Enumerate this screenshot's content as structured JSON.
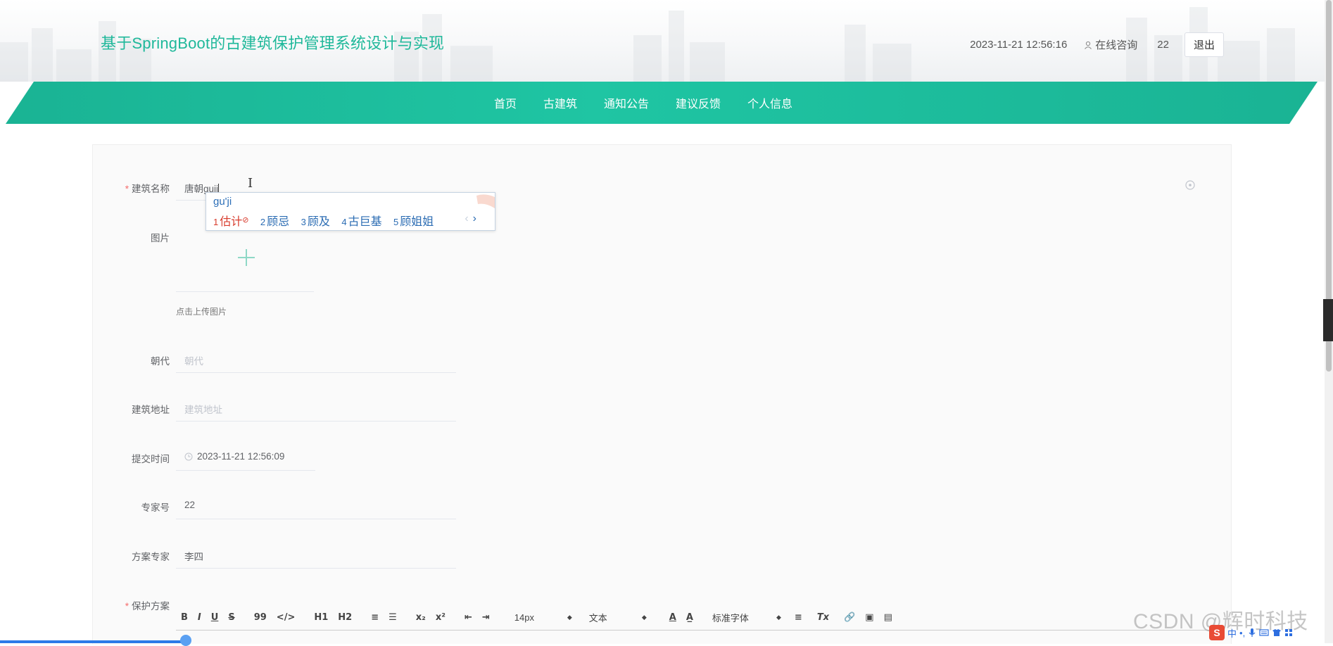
{
  "header": {
    "title": "基于SpringBoot的古建筑保护管理系统设计与实现",
    "datetime": "2023-11-21 12:56:16",
    "consult_label": "在线咨询",
    "user_id": "22",
    "logout_label": "退出"
  },
  "nav": {
    "items": [
      "首页",
      "古建筑",
      "通知公告",
      "建议反馈",
      "个人信息"
    ]
  },
  "form": {
    "building_name": {
      "label": "建筑名称",
      "value": "唐朝guij"
    },
    "image": {
      "label": "图片",
      "tip": "点击上传图片"
    },
    "dynasty": {
      "label": "朝代",
      "placeholder": "朝代"
    },
    "address": {
      "label": "建筑地址",
      "placeholder": "建筑地址"
    },
    "submit_time": {
      "label": "提交时间",
      "value": "2023-11-21 12:56:09"
    },
    "expert_no": {
      "label": "专家号",
      "value": "22"
    },
    "expert": {
      "label": "方案专家",
      "value": "李四"
    },
    "plan": {
      "label": "保护方案"
    }
  },
  "editor_toolbar": {
    "buttons": [
      "B",
      "I",
      "U",
      "S",
      "99",
      "</>",
      "H1",
      "H2",
      "≡",
      "☰",
      "x₂",
      "x²",
      "⇤",
      "⇥"
    ],
    "font_size": "14px",
    "block_type": "文本",
    "font_family": "标准字体",
    "more_buttons": [
      "A",
      "A̲",
      "≡",
      "Tx",
      "🔗",
      "▣",
      "▤"
    ]
  },
  "ime": {
    "composition": "gu'ji",
    "candidates": [
      {
        "n": "1",
        "text": "估计"
      },
      {
        "n": "2",
        "text": "顾忌"
      },
      {
        "n": "3",
        "text": "顾及"
      },
      {
        "n": "4",
        "text": "古巨基"
      },
      {
        "n": "5",
        "text": "顾姐姐"
      }
    ],
    "prev": "‹",
    "next": "›"
  },
  "watermark": "CSDN @辉时科技",
  "tray": {
    "ime_badge": "S",
    "lang": "中",
    "punct": "•,",
    "icons": [
      "mic-icon",
      "keyboard-icon",
      "shirt-icon",
      "grid-icon"
    ]
  },
  "colors": {
    "accent": "#1ab394",
    "title": "#1fb89a",
    "required": "#f56c6c",
    "ime_selected": "#d83b2c"
  }
}
